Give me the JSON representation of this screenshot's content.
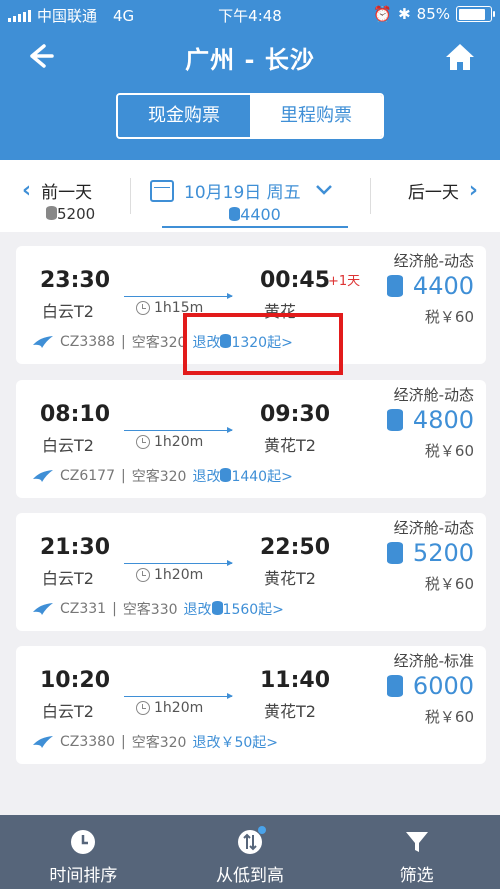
{
  "status": {
    "carrier": "中国联通",
    "network": "4G",
    "time": "下午4:48",
    "battery": "85%",
    "battery_level": 0.85
  },
  "header": {
    "title": "广州 - 长沙"
  },
  "segments": [
    {
      "label": "现金购票",
      "active": false
    },
    {
      "label": "里程购票",
      "active": true
    }
  ],
  "datebar": {
    "prev_label": "前一天",
    "prev_price": "5200",
    "current_date": "10月19日 周五",
    "current_price": "4400",
    "next_label": "后一天"
  },
  "flights": [
    {
      "dep_time": "23:30",
      "arr_time": "00:45",
      "plus_day": "+1天",
      "dep_airport": "白云T2",
      "arr_airport": "黄花",
      "duration": "1h15m",
      "flight_no": "CZ3388",
      "aircraft": "空客320",
      "refund_prefix": "退改",
      "refund_value": "1320起>",
      "cabin": "经济舱-动态",
      "price": "4400",
      "tax": "税￥60"
    },
    {
      "dep_time": "08:10",
      "arr_time": "09:30",
      "plus_day": "",
      "dep_airport": "白云T2",
      "arr_airport": "黄花T2",
      "duration": "1h20m",
      "flight_no": "CZ6177",
      "aircraft": "空客320",
      "refund_prefix": "退改",
      "refund_value": "1440起>",
      "cabin": "经济舱-动态",
      "price": "4800",
      "tax": "税￥60"
    },
    {
      "dep_time": "21:30",
      "arr_time": "22:50",
      "plus_day": "",
      "dep_airport": "白云T2",
      "arr_airport": "黄花T2",
      "duration": "1h20m",
      "flight_no": "CZ331",
      "aircraft": "空客330",
      "refund_prefix": "退改",
      "refund_value": "1560起>",
      "cabin": "经济舱-动态",
      "price": "5200",
      "tax": "税￥60"
    },
    {
      "dep_time": "10:20",
      "arr_time": "11:40",
      "plus_day": "",
      "dep_airport": "白云T2",
      "arr_airport": "黄花T2",
      "duration": "1h20m",
      "flight_no": "CZ3380",
      "aircraft": "空客320",
      "refund_prefix": "退改",
      "refund_value": "￥50起>",
      "cabin": "经济舱-标准",
      "price": "6000",
      "tax": "税￥60"
    }
  ],
  "tabs": [
    {
      "label": "时间排序"
    },
    {
      "label": "从低到高"
    },
    {
      "label": "筛选"
    }
  ],
  "colors": {
    "brand": "#3f8fd6",
    "tabbar": "#56657a",
    "highlight": "#e21b1b"
  }
}
